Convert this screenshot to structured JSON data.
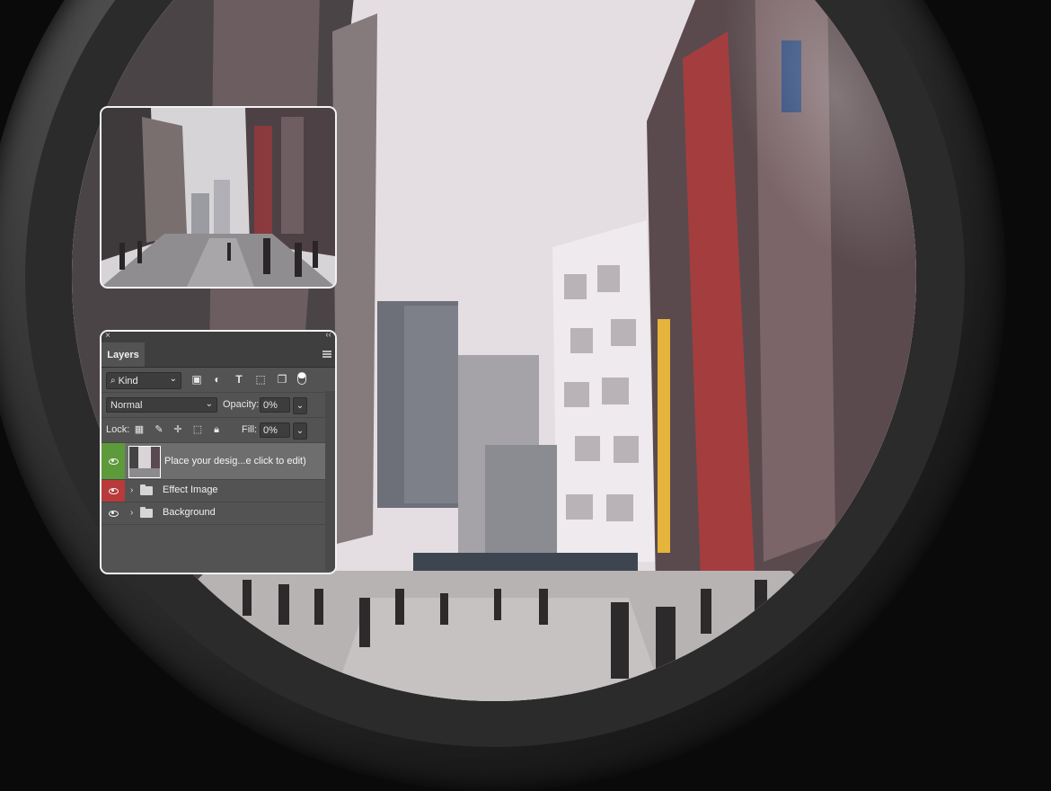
{
  "layers_panel": {
    "tab_label": "Layers",
    "filter_kind": "Kind",
    "blend_mode": "Normal",
    "opacity_label": "Opacity:",
    "opacity_value": "0%",
    "lock_label": "Lock:",
    "fill_label": "Fill:",
    "fill_value": "0%",
    "layers": [
      {
        "name": "Place your desig...e click to edit)",
        "visibility_color": "#5d9a3a",
        "type": "smart-object"
      },
      {
        "name": "Effect Image",
        "visibility_color": "#b83a3a",
        "type": "group"
      },
      {
        "name": "Background",
        "visibility_color": "",
        "type": "group"
      }
    ]
  },
  "icons": {
    "close": "close-icon",
    "collapse": "double-chevron-icon",
    "panel_menu": "hamburger-icon",
    "search": "search-icon",
    "filter_pixel": "image-filter-icon",
    "filter_adjustment": "adjustment-filter-icon",
    "filter_type": "type-filter-icon",
    "filter_shape": "shape-filter-icon",
    "filter_smart": "smart-object-filter-icon",
    "filter_toggle": "filter-toggle-icon",
    "lock_transparent": "lock-transparent-icon",
    "lock_paint": "lock-paint-icon",
    "lock_move": "lock-move-icon",
    "lock_artboard": "lock-artboard-icon",
    "lock_all": "lock-all-icon",
    "eye": "eye-icon",
    "folder": "folder-icon",
    "expand": "chevron-right-icon"
  },
  "colors": {
    "panel_bg": "#535353",
    "panel_dark": "#3f3f3f",
    "selected_row": "#6e6e6e",
    "eye_green": "#5d9a3a",
    "eye_red": "#b83a3a",
    "frame_border": "#f2f2f2"
  }
}
